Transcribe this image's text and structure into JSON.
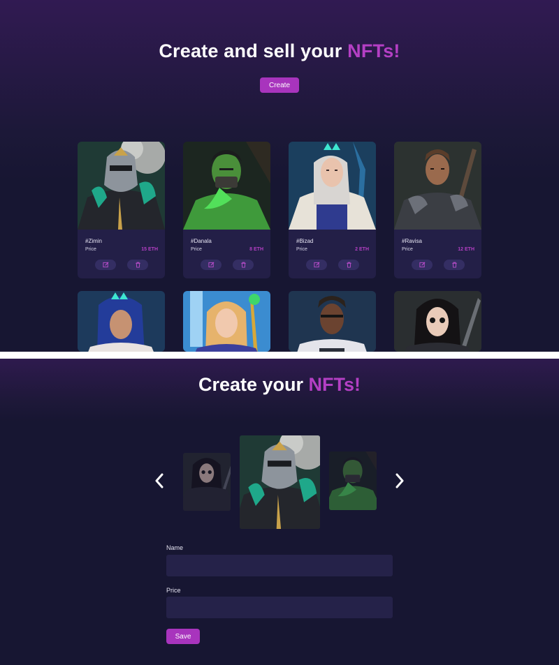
{
  "hero": {
    "title_prefix": "Create and sell your ",
    "title_accent": "NFTs!",
    "create_label": "Create"
  },
  "cards": [
    {
      "name": "#Zimin",
      "price_label": "Price",
      "price": "15 ETH",
      "art": "armored-knight-art"
    },
    {
      "name": "#Danala",
      "price_label": "Price",
      "price": "8 ETH",
      "art": "orc-warrior-art"
    },
    {
      "name": "#Bizad",
      "price_label": "Price",
      "price": "2 ETH",
      "art": "elf-mage-art"
    },
    {
      "name": "#Ravisa",
      "price_label": "Price",
      "price": "12 ETH",
      "art": "swordsman-art"
    }
  ],
  "cards_row2_art": [
    "blue-hair-warrior-art",
    "blonde-mage-art",
    "eyepatch-warrior-art",
    "dark-hair-rogue-art"
  ],
  "form": {
    "title_prefix": "Create your ",
    "title_accent": "NFTs!",
    "carousel": {
      "prev_icon": "chevron-left-icon",
      "next_icon": "chevron-right-icon",
      "items": [
        "dark-hair-rogue-art",
        "armored-knight-art",
        "orc-warrior-art"
      ],
      "selected": "armored-knight-art"
    },
    "name_label": "Name",
    "name_value": "",
    "price_label": "Price",
    "price_value": "",
    "save_label": "Save"
  },
  "colors": {
    "accent": "#b43fc4",
    "button": "#a834bd",
    "background": "#171632",
    "card": "#231f47",
    "input": "#252249"
  }
}
